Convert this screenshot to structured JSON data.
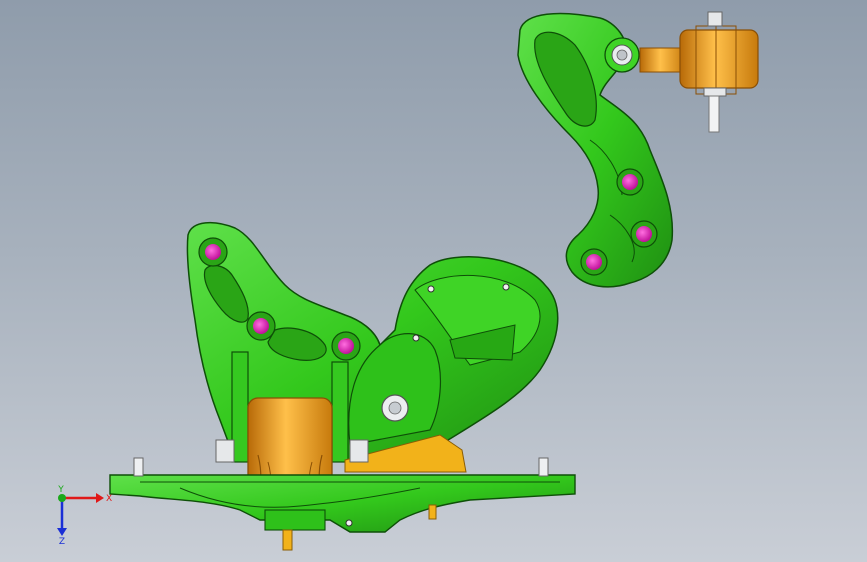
{
  "viewport": {
    "background_top": "#8f9cab",
    "background_bottom": "#c9ced6"
  },
  "model": {
    "bracket_color": "#33c81c",
    "bracket_edge_color": "#0e4f08",
    "bushing_color": "#f2a21a",
    "bolt_hole_color": "#e21ab8",
    "parts": [
      "upper-link-arm",
      "engine-mount-bracket",
      "mount-base-plate",
      "rubber-bushing",
      "bushing-end-fitting",
      "plate-pin"
    ]
  },
  "triad": {
    "x_label": "X",
    "y_label": "Y",
    "z_label": "Z",
    "x_color": "#e01818",
    "y_color": "#1aa81a",
    "z_color": "#1a2fd6"
  }
}
